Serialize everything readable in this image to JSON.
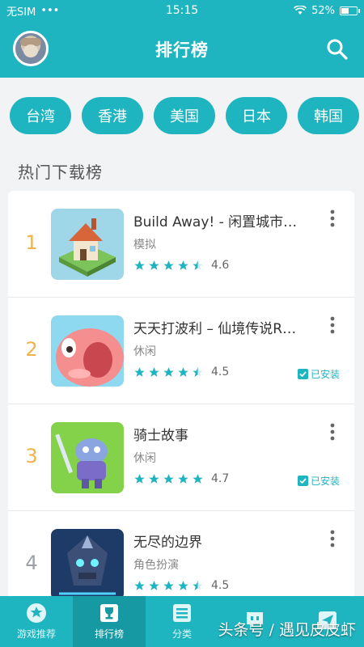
{
  "status_bar": {
    "carrier": "无SIM",
    "dots": "•••",
    "time": "15:15",
    "battery": "52%",
    "battery_level": 0.52
  },
  "header": {
    "title": "排行榜"
  },
  "regions": [
    "台湾",
    "香港",
    "美国",
    "日本",
    "韩国"
  ],
  "section_title": "热门下载榜",
  "apps": [
    {
      "rank": "1",
      "name": " Build Away! - 闲置城市…",
      "category": "模拟",
      "rating": "4.6",
      "installed": ""
    },
    {
      "rank": "2",
      "name": "天天打波利 – 仙境传说R…",
      "category": "休闲",
      "rating": "4.5",
      "installed": "已安装"
    },
    {
      "rank": "3",
      "name": "骑士故事",
      "category": "休闲",
      "rating": "4.7",
      "installed": "已安装"
    },
    {
      "rank": "4",
      "name": "无尽的边界",
      "category": "角色扮演",
      "rating": "4.5",
      "installed": ""
    }
  ],
  "bottom_nav": [
    {
      "label": "游戏推荐",
      "icon": "star-icon"
    },
    {
      "label": "排行榜",
      "icon": "trophy-icon"
    },
    {
      "label": "分类",
      "icon": "list-icon"
    },
    {
      "label": "",
      "icon": "chat-icon"
    },
    {
      "label": "",
      "icon": "send-icon"
    }
  ],
  "watermark": "头条号 / 遇见皮皮虾",
  "colors": {
    "accent": "#1fb5c0",
    "rank_gold": "#f0b24a"
  }
}
